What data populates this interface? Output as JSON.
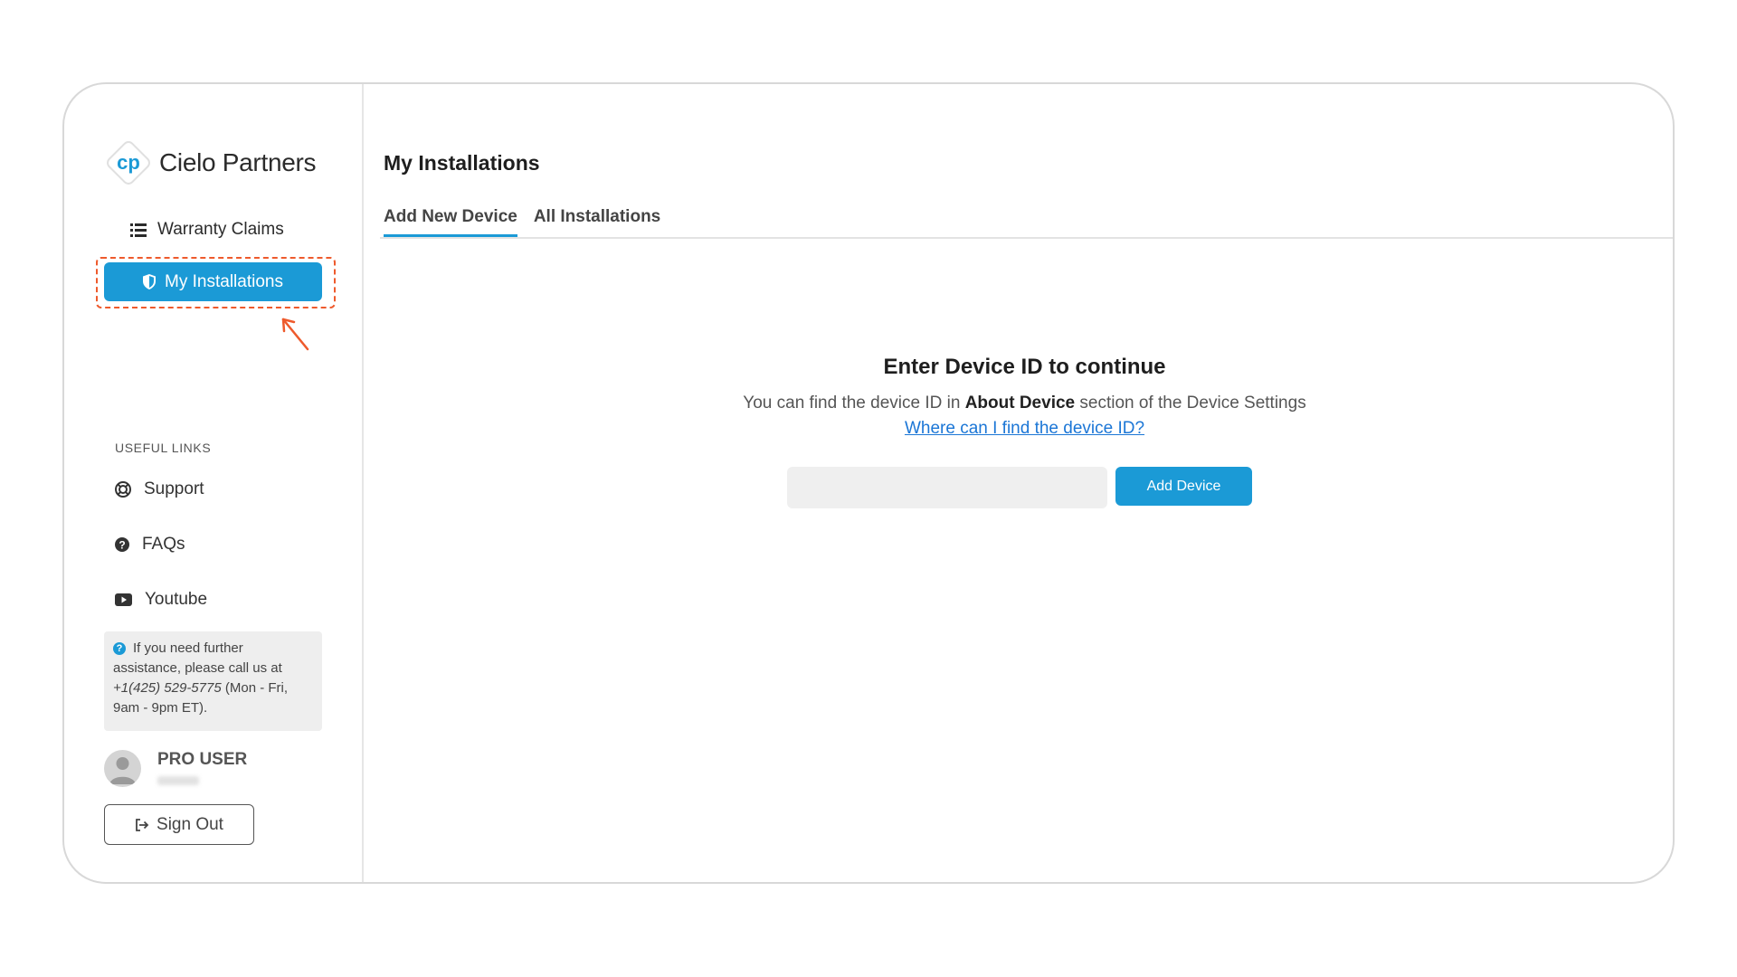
{
  "brand": {
    "name": "Cielo Partners",
    "accent_color": "#1b9ad6"
  },
  "sidebar": {
    "nav": [
      {
        "label": "Warranty Claims",
        "icon": "list-icon"
      },
      {
        "label": "My Installations",
        "icon": "shield-icon",
        "active": true
      }
    ],
    "useful_links_title": "USEFUL LINKS",
    "useful_links": [
      {
        "label": "Support",
        "icon": "lifebuoy-icon"
      },
      {
        "label": "FAQs",
        "icon": "question-circle-icon"
      },
      {
        "label": "Youtube",
        "icon": "youtube-icon"
      }
    ],
    "help": {
      "text_before": "If you need further assistance, please call us at ",
      "phone": "+1(425) 529-5775",
      "text_after": " (Mon - Fri, 9am - 9pm ET)."
    },
    "user": {
      "name": "PRO USER"
    },
    "sign_out_label": "Sign Out"
  },
  "main": {
    "title": "My Installations",
    "tabs": [
      {
        "label": "Add New Device",
        "active": true
      },
      {
        "label": "All Installations",
        "active": false
      }
    ],
    "prompt_title": "Enter Device ID to continue",
    "prompt_desc_before": "You can find the device ID in ",
    "prompt_desc_bold": "About Device",
    "prompt_desc_after": " section of the Device Settings",
    "help_link": "Where can I find the device ID?",
    "device_input": {
      "value": "",
      "placeholder": ""
    },
    "add_button_label": "Add Device"
  },
  "annotation_color": "#ee5a2c"
}
